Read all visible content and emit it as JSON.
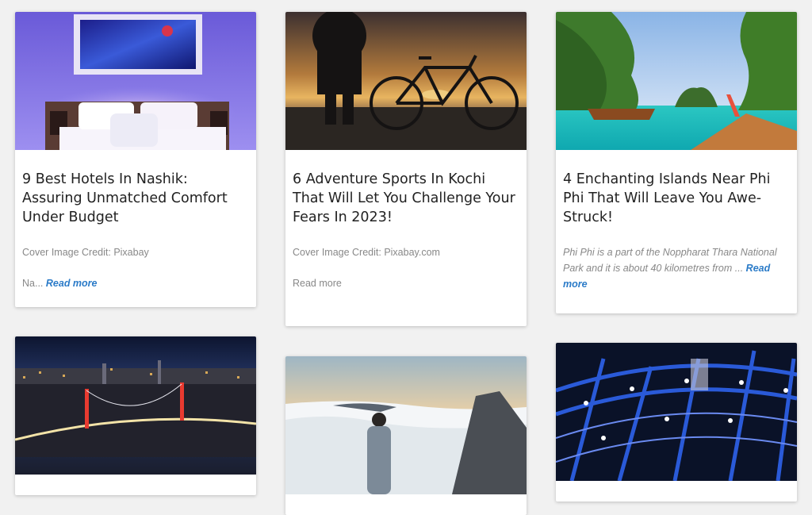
{
  "cards": [
    {
      "title": "9 Best Hotels In Nashik: Assuring Unmatched Comfort Under Budget",
      "credit": "Cover Image Credit: Pixabay",
      "excerpt_prefix": "Na...",
      "read_more": "Read more",
      "image": "hotel-bedroom-image"
    },
    {
      "title": "6 Adventure Sports In Kochi That Will Let You Challenge Your Fears In 2023!",
      "credit": "Cover Image Credit: Pixabay.com",
      "read_more": "Read more",
      "image": "cyclist-sunset-image"
    },
    {
      "title": "4 Enchanting Islands Near Phi Phi That Will Leave You Awe-Struck!",
      "excerpt": "Phi Phi is a part of the Noppharat Thara National Park and it is about 40 kilometres from ...",
      "read_more": "Read more",
      "image": "phi-phi-islands-image"
    },
    {
      "image": "city-bridge-night-image"
    },
    {
      "image": "hiker-above-clouds-image"
    },
    {
      "image": "helix-bridge-night-image"
    }
  ],
  "colors": {
    "page_bg": "#f1f1f1",
    "card_bg": "#ffffff",
    "title": "#222222",
    "muted": "#888888",
    "link": "#2b7bc8"
  }
}
